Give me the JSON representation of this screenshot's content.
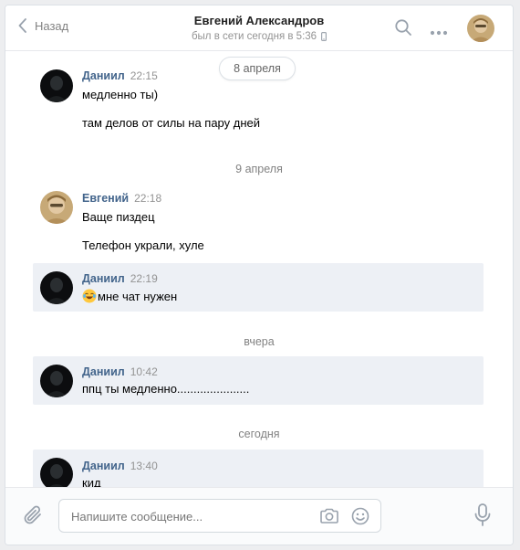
{
  "header": {
    "back_label": "Назад",
    "peer_name": "Евгений Александров",
    "peer_status": "был в сети сегодня в 5:36",
    "icons": [
      "search-icon",
      "more-icon",
      "avatar"
    ]
  },
  "messages": {
    "dates": {
      "d1": "8 апреля",
      "d2": "9 апреля",
      "d3": "вчера",
      "d4": "сегодня"
    },
    "groups": [
      {
        "author": "Даниил",
        "time": "22:15",
        "lines": [
          "медленно ты)",
          "там делов от силы на пару дней"
        ]
      },
      {
        "author": "Евгений",
        "time": "22:18",
        "lines": [
          "Ваще пиздец",
          "Телефон украли, хуле"
        ]
      },
      {
        "author": "Даниил",
        "time": "22:19",
        "lines": [
          "мне чат нужен"
        ]
      },
      {
        "author": "Даниил",
        "time": "10:42",
        "lines": [
          "ппц ты медленно......................"
        ]
      },
      {
        "author": "Даниил",
        "time": "13:40",
        "lines": [
          "кид"
        ]
      }
    ]
  },
  "composer": {
    "placeholder": "Напишите сообщение...",
    "icons": [
      "attach-icon",
      "camera-icon",
      "smile-icon",
      "microphone-icon"
    ]
  },
  "colors": {
    "author": "#42648b",
    "highlight": "#edf0f5",
    "icon": "#99a2ad"
  }
}
